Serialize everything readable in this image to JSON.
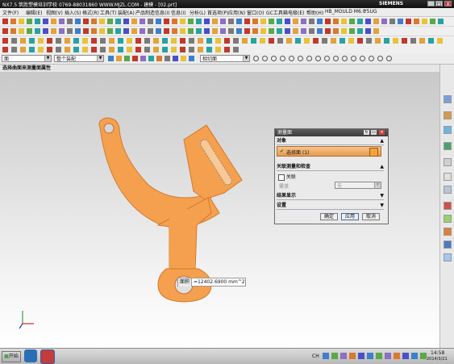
{
  "titlebar": {
    "title": "NX7.5  筑胜塑模培训学校 0769-88031860 WWW.MJZL.COM - 建模 - [02.prt]",
    "brand": "SIEMENS",
    "min": "_",
    "max": "□",
    "close": "X"
  },
  "menu": [
    "文件(F)",
    "编辑(E)",
    "视图(V)",
    "插入(S)",
    "格式(R)",
    "工具(T)",
    "装配(A)",
    "产品制造信息(I)",
    "信息(I)",
    "分析(L)",
    "首选项(P)",
    "应用(N)",
    "窗口(O)",
    "GC工具箱",
    "电极(E)",
    "帮助(H)",
    "HB_MOULD M6.0",
    "Y5UG"
  ],
  "selection_bar": {
    "filter_value": "面",
    "assembly_value": "整个装配",
    "snap_value": "相切面"
  },
  "cue_line": "选择曲面来测量面属性",
  "readout": {
    "label": "面积",
    "value": "=12402.6900 mm^2"
  },
  "dialog": {
    "title": "测量面",
    "object_section": "对象",
    "select_face": "选择面 (1)",
    "association_section": "关联测量和检查",
    "association_checkbox": "关联",
    "requirement_label": "需求",
    "requirement_value": "无",
    "result_section": "结果显示",
    "settings_section": "设置",
    "ok": "确定",
    "apply": "应用",
    "cancel": "取消"
  },
  "taskbar": {
    "start": "开始",
    "ime": "CH",
    "time": "14:58",
    "date": "2014/3/21"
  },
  "colors": {
    "part": "#f5a04e",
    "part_edge": "#d27a30",
    "dialog_select": "#eaa25a",
    "title_bg": "#1f1f1f"
  }
}
